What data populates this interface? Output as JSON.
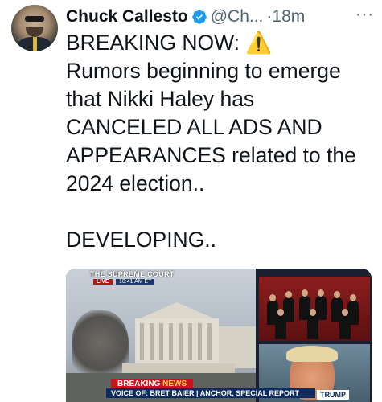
{
  "tweet": {
    "author_name": "Chuck Callesto",
    "handle": "@Ch...",
    "timestamp": "·18m",
    "more_label": "···",
    "text": "BREAKING NOW: ⚠️\nRumors beginning to emerge that Nikki Haley has CANCELED ALL ADS AND APPEARANCES related to the 2024 election..\n\nDEVELOPING.."
  },
  "media": {
    "channel_bug": "THE SUPREME COURT",
    "live_label": "LIVE",
    "time_label": "10:41 AM ET",
    "breaking_prefix": "BREAKING ",
    "breaking_highlight": "NEWS",
    "voice_bar": "VOICE OF: BRET BAIER | ANCHOR, SPECIAL REPORT",
    "name_tag": "TRUMP"
  },
  "colors": {
    "verified": "#1d9bf0",
    "warning": "#f4c20d",
    "text_primary": "#0f1419",
    "text_secondary": "#536471"
  },
  "icons": {
    "verified": "verified-badge-icon",
    "more": "more-options-icon",
    "warning": "warning-sign-icon"
  }
}
